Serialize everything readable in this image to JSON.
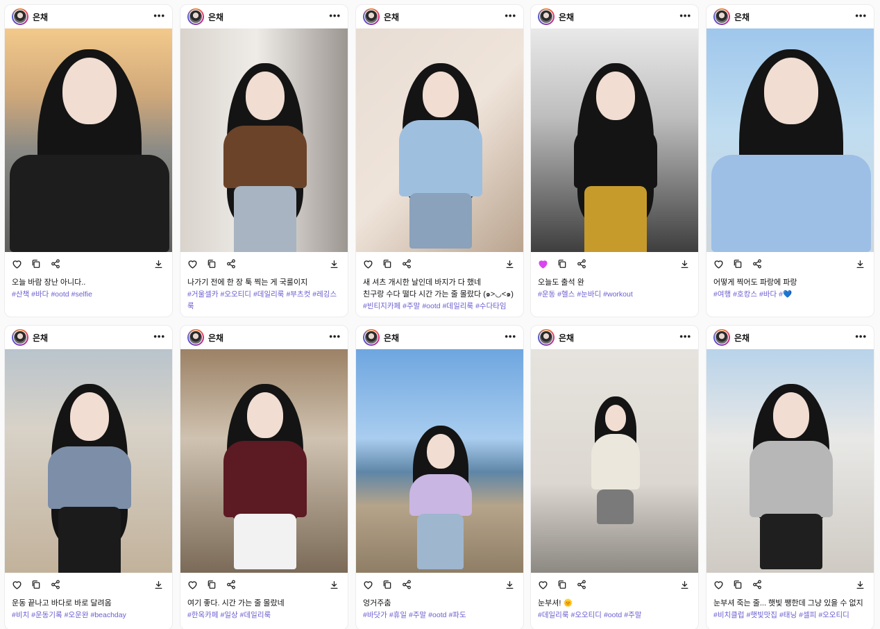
{
  "user": {
    "name": "은채"
  },
  "colors": {
    "tag": "#6b5fd0",
    "liked": "#d946ef"
  },
  "icons": [
    "more-icon",
    "heart-icon",
    "copy-icon",
    "share-icon",
    "download-icon"
  ],
  "posts": [
    {
      "caption": "오늘 바람 장난 아니다..",
      "liked": false,
      "tags": [
        "#산책",
        "#바다",
        "#ootd",
        "#selfie"
      ]
    },
    {
      "caption": "나가기 전에 한 장 툭 찍는 게 국룰이지",
      "liked": false,
      "tags": [
        "#거울셀카",
        "#오오티디",
        "#데일리룩",
        "#부츠컷",
        "#레깅스룩"
      ]
    },
    {
      "caption": "새 셔츠 개시한 날인데 바지가 다 했네",
      "caption2": "친구랑 수다 떨다 시간 가는 줄 몰랐다 (๑>◡<๑)",
      "liked": false,
      "tags": [
        "#빈티지카페",
        "#주말",
        "#ootd",
        "#데일리룩",
        "#수다타임"
      ]
    },
    {
      "caption": "오늘도 출석 완",
      "liked": true,
      "tags": [
        "#운동",
        "#헬스",
        "#눈바디",
        "#workout"
      ]
    },
    {
      "caption": "어떻게 찍어도 파랑에 파랑",
      "liked": false,
      "tags": [
        "#여행",
        "#호캉스",
        "#바다",
        "#💙"
      ]
    },
    {
      "caption": "운동 끝나고 바다로 바로 달려옴",
      "liked": false,
      "tags": [
        "#비치",
        "#운동기록",
        "#오운완",
        "#beachday"
      ]
    },
    {
      "caption": "여기 좋다. 시간 가는 줄 몰랐네",
      "liked": false,
      "tags": [
        "#한옥카페",
        "#일상",
        "#데일리룩"
      ]
    },
    {
      "caption": "엉거주춤",
      "liked": false,
      "tags": [
        "#바닷가",
        "#휴일",
        "#주말",
        "#ootd",
        "#파도"
      ]
    },
    {
      "caption": "눈부셔! 🌞",
      "liked": false,
      "tags": [
        "#데일리룩",
        "#오오티디",
        "#ootd",
        "#주말"
      ]
    },
    {
      "caption": "눈부셔 죽는 줄... 햇빛 쨍한데 그냥 있을 수 없지",
      "liked": false,
      "tags": [
        "#비치클럽",
        "#햇빛맛집",
        "#태닝",
        "#셀피",
        "#오오티디"
      ]
    }
  ]
}
